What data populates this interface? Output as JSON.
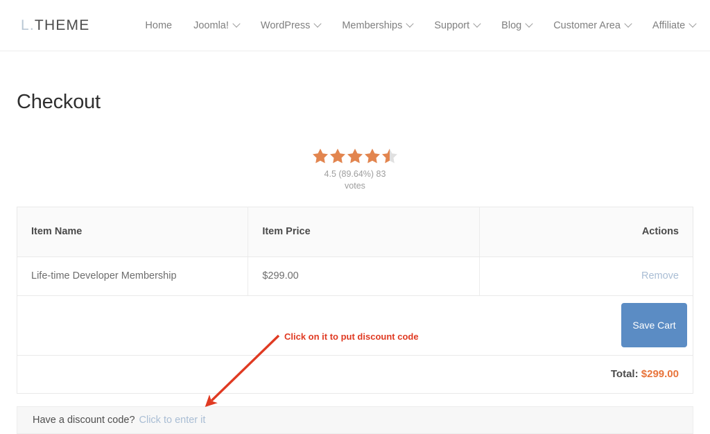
{
  "header": {
    "logo_prefix": "L.",
    "logo_name": "THEME",
    "nav": [
      {
        "label": "Home",
        "has_caret": false
      },
      {
        "label": "Joomla!",
        "has_caret": true
      },
      {
        "label": "WordPress",
        "has_caret": true
      },
      {
        "label": "Memberships",
        "has_caret": true
      },
      {
        "label": "Support",
        "has_caret": true
      },
      {
        "label": "Blog",
        "has_caret": true
      },
      {
        "label": "Customer Area",
        "has_caret": true
      },
      {
        "label": "Affiliate",
        "has_caret": true
      }
    ],
    "search_icon": "search-icon"
  },
  "page": {
    "title": "Checkout"
  },
  "rating": {
    "score": 4.5,
    "max": 5,
    "full_stars": 4,
    "half_star": true,
    "text_line1": "4.5 (89.64%) 83",
    "text_line2": "votes",
    "star_color": "#e2854f",
    "star_empty_color": "#e0e0e0"
  },
  "cart": {
    "columns": [
      "Item Name",
      "Item Price",
      "Actions"
    ],
    "rows": [
      {
        "item_name": "Life-time Developer Membership",
        "item_price": "$299.00",
        "action_label": "Remove"
      }
    ],
    "save_cart_label": "Save Cart",
    "total_label": "Total:",
    "total_value": "$299.00",
    "total_color": "#e8743b",
    "save_button_color": "#5b8cc4"
  },
  "discount": {
    "prompt": "Have a discount code?",
    "link_label": "Click to enter it"
  },
  "annotation": {
    "text": "Click on it to put discount code",
    "color": "#e03a22"
  }
}
